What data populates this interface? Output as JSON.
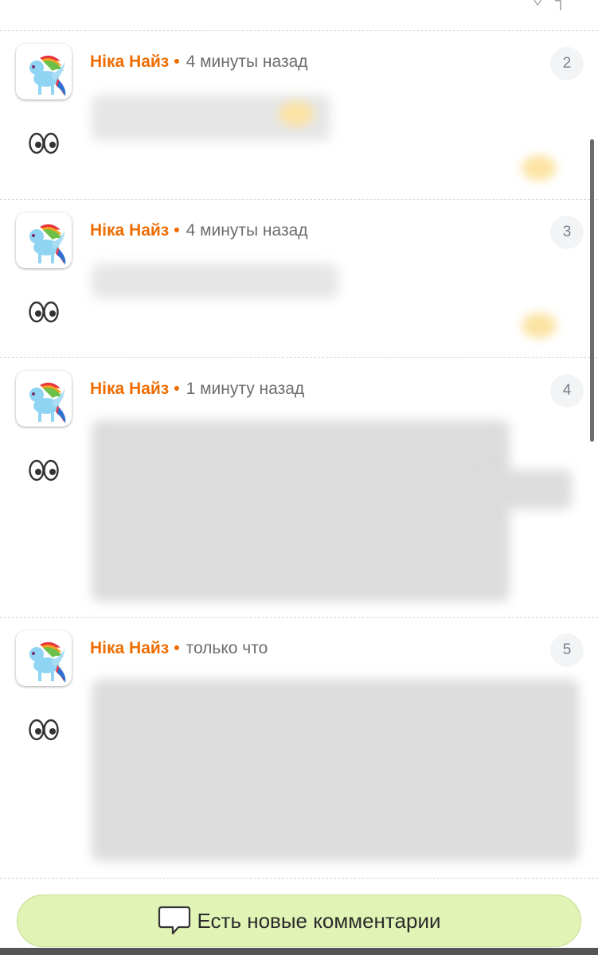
{
  "comments": [
    {
      "author": "Ніка Найз",
      "separator": "•",
      "time": "4 минуты назад",
      "number": "2"
    },
    {
      "author": "Ніка Найз",
      "separator": "•",
      "time": "4 минуты назад",
      "number": "3"
    },
    {
      "author": "Ніка Найз",
      "separator": "•",
      "time": "1 минуту назад",
      "number": "4"
    },
    {
      "author": "Ніка Найз",
      "separator": "•",
      "time": "только что",
      "number": "5"
    }
  ],
  "new_comments_button": {
    "label": "Есть новые комментарии",
    "icon": "speech-bubble-icon"
  },
  "icons": {
    "avatar": "pony-avatar-icon",
    "reaction": "eyes-icon"
  },
  "colors": {
    "author": "#ef6c00",
    "button_bg": "#e2f3b6",
    "badge_bg": "#f3f4f6"
  }
}
